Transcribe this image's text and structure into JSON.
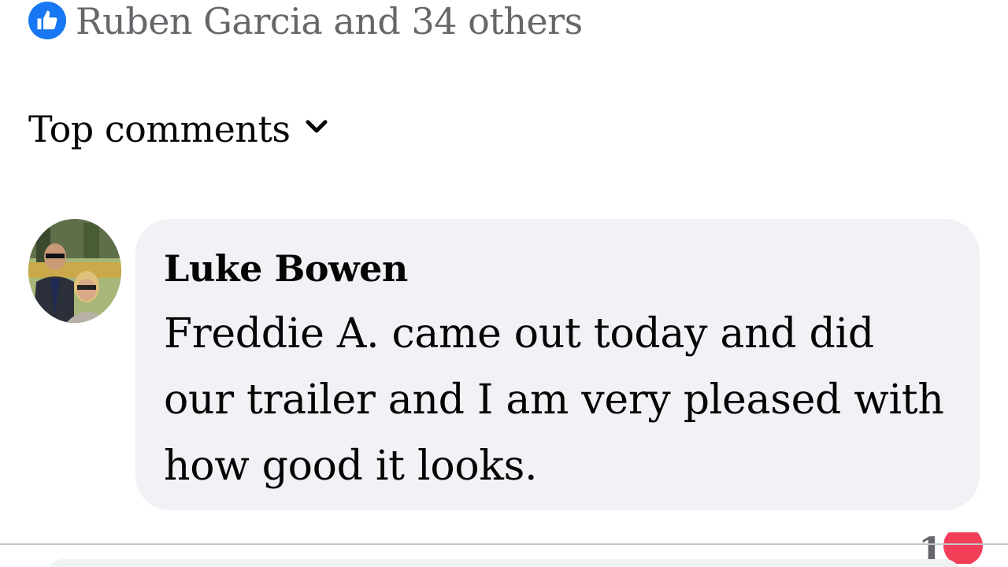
{
  "reactions": {
    "icon": "like-icon",
    "summary": "Ruben Garcia and 34 others"
  },
  "comments_header": {
    "sort_label": "Top comments",
    "sort_icon": "chevron-down-icon"
  },
  "comment": {
    "author": "Luke Bowen",
    "text": "Freddie A. came out today and did our trailer and I am very pleased with how good it looks.",
    "reaction_count": "1",
    "reaction_icon": "heart-icon"
  },
  "colors": {
    "accent_blue": "#1877f2",
    "love_red": "#f33e58",
    "muted_text": "#65676b",
    "bubble_bg": "#f0f2f5"
  }
}
